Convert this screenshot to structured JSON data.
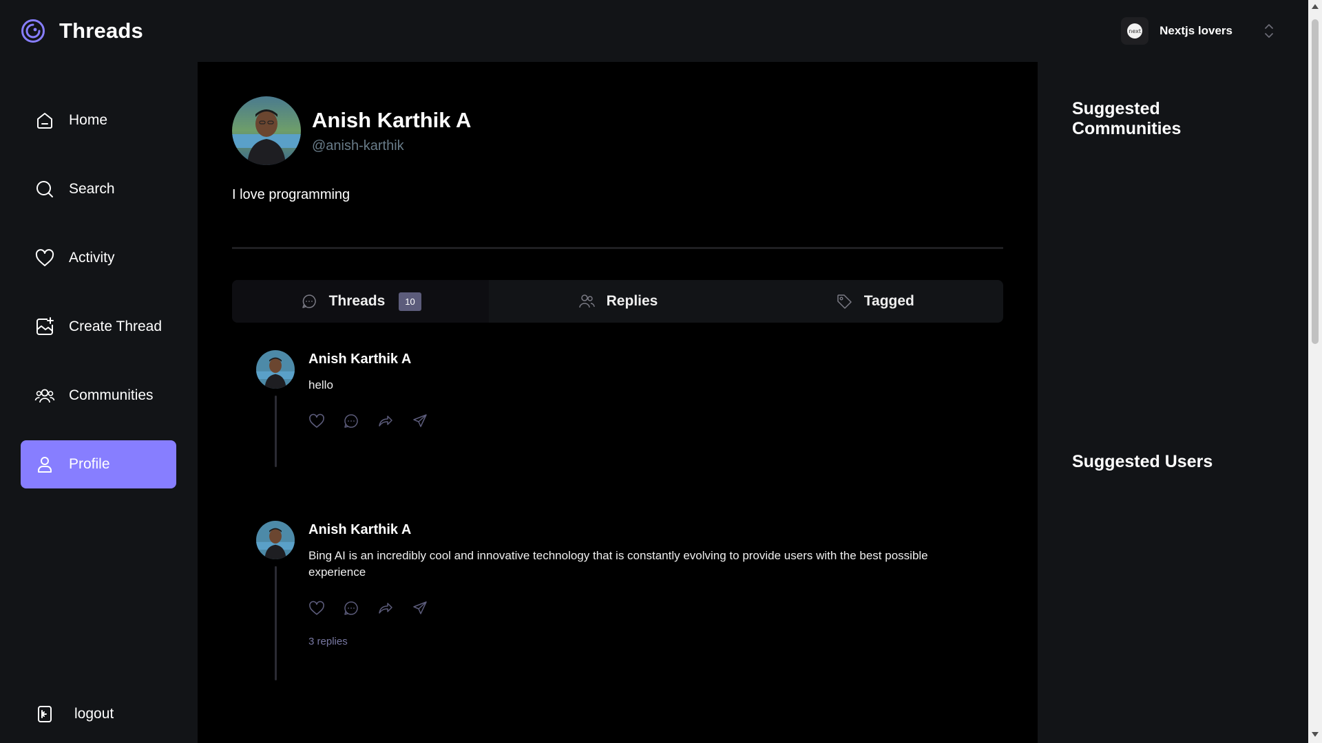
{
  "app": {
    "title": "Threads"
  },
  "org_switcher": {
    "name": "Nextjs lovers",
    "avatar_text": "next"
  },
  "nav": {
    "items": [
      {
        "label": "Home",
        "icon": "home-icon"
      },
      {
        "label": "Search",
        "icon": "search-icon"
      },
      {
        "label": "Activity",
        "icon": "heart-icon"
      },
      {
        "label": "Create Thread",
        "icon": "create-thread-icon"
      },
      {
        "label": "Communities",
        "icon": "communities-icon"
      },
      {
        "label": "Profile",
        "icon": "user-icon",
        "active": true
      }
    ],
    "logout_label": "logout"
  },
  "profile": {
    "name": "Anish Karthik A",
    "handle": "@anish-karthik",
    "bio": "I love programming"
  },
  "tabs": [
    {
      "label": "Threads",
      "badge": "10",
      "icon": "reply-bubble-icon",
      "selected": true
    },
    {
      "label": "Replies",
      "icon": "members-icon"
    },
    {
      "label": "Tagged",
      "icon": "tag-icon"
    }
  ],
  "threads": [
    {
      "author": "Anish Karthik A",
      "text": "hello",
      "replies": ""
    },
    {
      "author": "Anish Karthik A",
      "text": "Bing AI is an incredibly cool and innovative technology that is constantly evolving to provide users with the best possible experience",
      "replies": "3 replies"
    }
  ],
  "right_sidebar": {
    "communities_heading": "Suggested Communities",
    "users_heading": "Suggested Users"
  },
  "colors": {
    "accent": "#877eff",
    "background_dark": "#121417",
    "main_background": "#000000",
    "muted_text": "#697c89"
  }
}
